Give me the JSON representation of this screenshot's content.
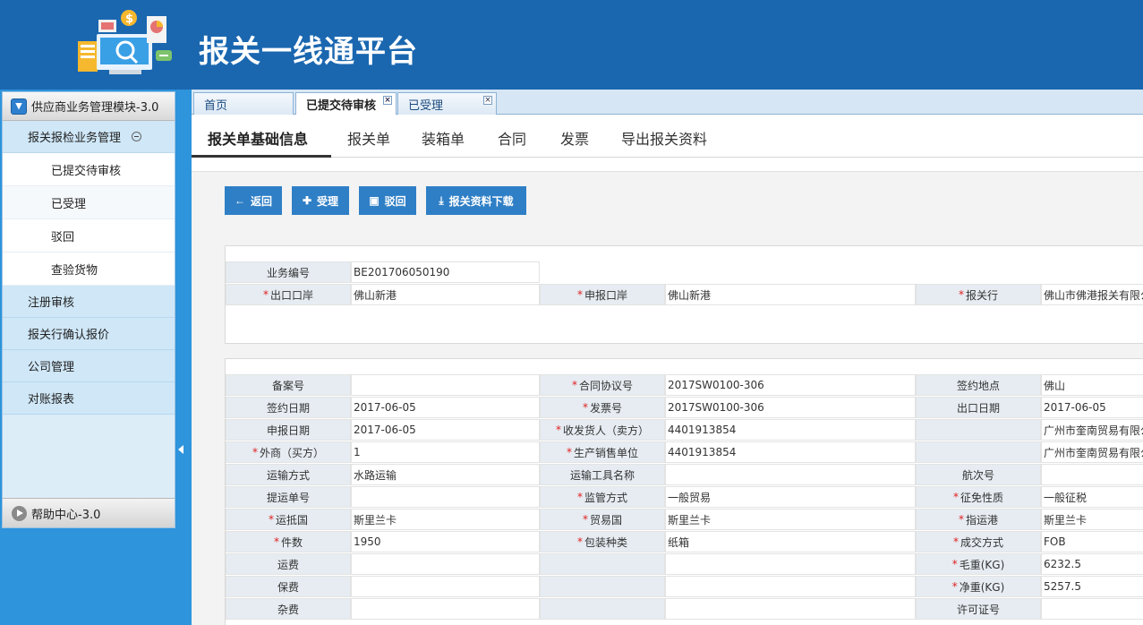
{
  "header": {
    "title": "报关一线通平台"
  },
  "menu": {
    "module_title": "供应商业务管理模块-3.0",
    "group_title": "报关报检业务管理",
    "sub_items": [
      "已提交待审核",
      "已受理",
      "驳回",
      "查验货物"
    ],
    "items": [
      "注册审核",
      "报关行确认报价",
      "公司管理",
      "对账报表"
    ],
    "help": "帮助中心-3.0"
  },
  "tabs": [
    {
      "label": "首页"
    },
    {
      "label": "已提交待审核"
    },
    {
      "label": "已受理"
    }
  ],
  "subnav": [
    "报关单基础信息",
    "报关单",
    "装箱单",
    "合同",
    "发票",
    "导出报关资料"
  ],
  "buttons": {
    "back": "返回",
    "accept": "受理",
    "reject": "驳回",
    "download": "报关资料下载"
  },
  "section1": [
    [
      {
        "label": "业务编号",
        "req": false,
        "value": "BE201706050190"
      }
    ],
    [
      {
        "label": "出口口岸",
        "req": true,
        "value": "佛山新港"
      },
      {
        "label": "申报口岸",
        "req": true,
        "value": "佛山新港"
      },
      {
        "label": "报关行",
        "req": true,
        "value": "佛山市佛港报关有限公司"
      }
    ]
  ],
  "section2": [
    [
      {
        "label": "备案号",
        "req": false,
        "value": ""
      },
      {
        "label": "合同协议号",
        "req": true,
        "value": "2017SW0100-306"
      },
      {
        "label": "签约地点",
        "req": false,
        "value": "佛山"
      }
    ],
    [
      {
        "label": "签约日期",
        "req": false,
        "value": "2017-06-05"
      },
      {
        "label": "发票号",
        "req": true,
        "value": "2017SW0100-306"
      },
      {
        "label": "出口日期",
        "req": false,
        "value": "2017-06-05"
      }
    ],
    [
      {
        "label": "申报日期",
        "req": false,
        "value": "2017-06-05"
      },
      {
        "label": "收发货人（卖方）",
        "req": true,
        "value": "4401913854"
      },
      {
        "label": "",
        "req": false,
        "value": "广州市奎南贸易有限公司"
      }
    ],
    [
      {
        "label": "外商（买方）",
        "req": true,
        "value": "1"
      },
      {
        "label": "生产销售单位",
        "req": true,
        "value": "4401913854"
      },
      {
        "label": "",
        "req": false,
        "value": "广州市奎南贸易有限公司"
      }
    ],
    [
      {
        "label": "运输方式",
        "req": false,
        "value": "水路运输"
      },
      {
        "label": "运输工具名称",
        "req": false,
        "value": ""
      },
      {
        "label": "航次号",
        "req": false,
        "value": ""
      }
    ],
    [
      {
        "label": "提运单号",
        "req": false,
        "value": ""
      },
      {
        "label": "监管方式",
        "req": true,
        "value": "一般贸易"
      },
      {
        "label": "征免性质",
        "req": true,
        "value": "一般征税"
      }
    ],
    [
      {
        "label": "运抵国",
        "req": true,
        "value": "斯里兰卡"
      },
      {
        "label": "贸易国",
        "req": true,
        "value": "斯里兰卡"
      },
      {
        "label": "指运港",
        "req": true,
        "value": "斯里兰卡"
      }
    ],
    [
      {
        "label": "件数",
        "req": true,
        "value": "1950"
      },
      {
        "label": "包装种类",
        "req": true,
        "value": "纸箱"
      },
      {
        "label": "成交方式",
        "req": true,
        "value": "FOB"
      }
    ],
    [
      {
        "label": "运费",
        "req": false,
        "value": ""
      },
      {
        "label": "",
        "req": false,
        "value": ""
      },
      {
        "label": "毛重(KG)",
        "req": true,
        "value": "6232.5"
      }
    ],
    [
      {
        "label": "保费",
        "req": false,
        "value": ""
      },
      {
        "label": "",
        "req": false,
        "value": ""
      },
      {
        "label": "净重(KG)",
        "req": true,
        "value": "5257.5"
      }
    ],
    [
      {
        "label": "杂费",
        "req": false,
        "value": ""
      },
      {
        "label": "",
        "req": false,
        "value": ""
      },
      {
        "label": "许可证号",
        "req": false,
        "value": ""
      }
    ]
  ]
}
